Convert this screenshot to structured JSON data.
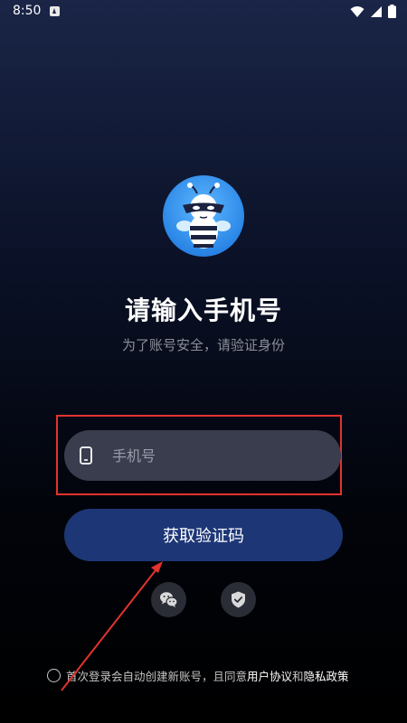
{
  "status_bar": {
    "time": "8:50"
  },
  "login": {
    "title": "请输入手机号",
    "subtitle": "为了账号安全，请验证身份",
    "phone_placeholder": "手机号",
    "get_code_label": "获取验证码"
  },
  "agreement": {
    "prefix": "首次登录会自动创建新账号，且同意",
    "user_agreement": "用户协议",
    "and": "和",
    "privacy_policy": "隐私政策"
  },
  "icons": {
    "wifi": "wifi-icon",
    "signal": "signal-icon",
    "battery": "battery-icon",
    "phone": "phone-icon",
    "wechat": "wechat-icon",
    "shield": "shield-check-icon"
  },
  "colors": {
    "button": "#1d3676",
    "input": "#3a3d4e",
    "highlight": "#e3332e",
    "annotation_arrow": "#e3332e"
  }
}
